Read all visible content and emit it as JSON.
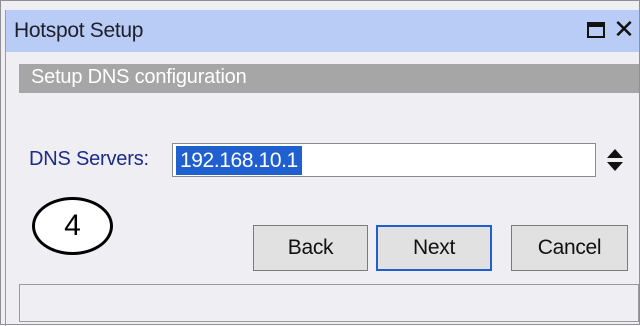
{
  "window": {
    "title": "Hotspot Setup"
  },
  "subheader": {
    "text": "Setup DNS configuration"
  },
  "dns": {
    "label": "DNS Servers:",
    "value": "192.168.10.1"
  },
  "step_badge": {
    "number": "4"
  },
  "buttons": {
    "back": "Back",
    "next": "Next",
    "cancel": "Cancel"
  },
  "icons": {
    "maximize": "maximize-icon",
    "close": "close-icon",
    "stepper": "up-down-stepper-icon"
  },
  "colors": {
    "titlebar": "#b9ccf6",
    "subheader": "#a6a6a6",
    "selection": "#1f5fcf",
    "label": "#1d2a8a"
  }
}
